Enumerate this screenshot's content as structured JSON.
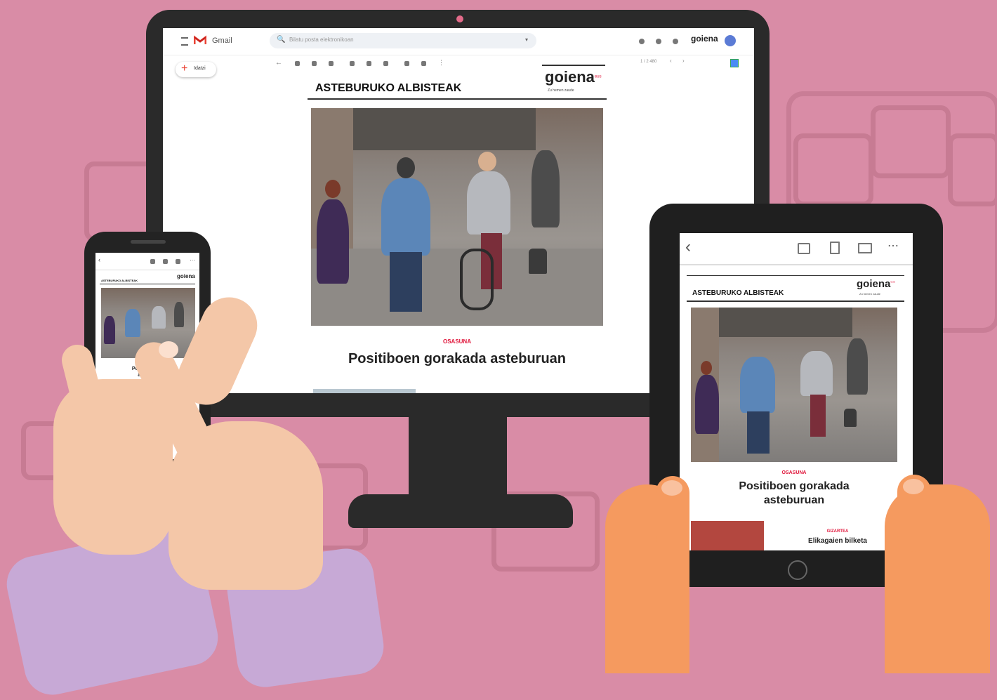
{
  "gmail": {
    "app_name": "Gmail",
    "search_placeholder": "Bilatu posta elektronikoan",
    "compose_label": "Idatzi",
    "pagination": "1 / 2 480"
  },
  "newsletter": {
    "header_title": "ASTEBURUKO ALBISTEAK",
    "logo_text": "goiena",
    "logo_sup": "eus",
    "logo_tagline": "Zu hemen zaude",
    "kicker": "OSASUNA",
    "headline": "Positiboen gorakada asteburuan",
    "headline_tablet_line1": "Positiboen gorakada",
    "headline_tablet_line2": "asteburuan",
    "phone_headline_line1": "Positiboen go",
    "phone_headline_line2": "asteburu",
    "second_kicker": "GIZARTEA",
    "second_headline": "Elikagaien bilketa"
  },
  "colors": {
    "background": "#d98ca6",
    "device": "#2a2a2a",
    "accent_red": "#e0153a"
  }
}
